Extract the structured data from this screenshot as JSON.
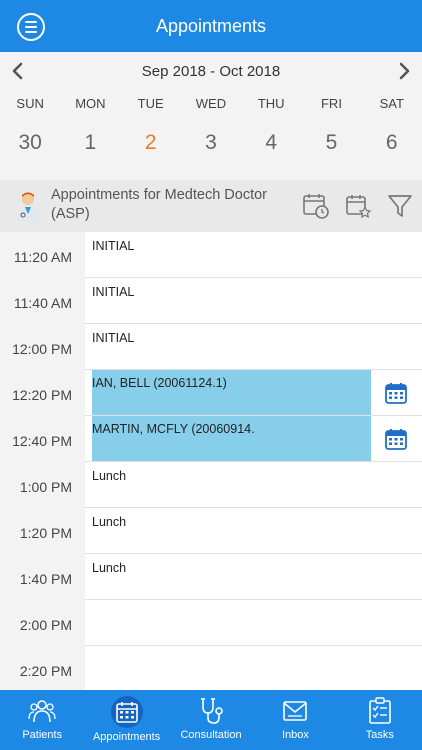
{
  "header": {
    "title": "Appointments"
  },
  "calendar": {
    "range": "Sep 2018 - Oct 2018",
    "days": [
      "SUN",
      "MON",
      "TUE",
      "WED",
      "THU",
      "FRI",
      "SAT"
    ],
    "dates": [
      "30",
      "1",
      "2",
      "3",
      "4",
      "5",
      "6"
    ],
    "today_color": "#e67e22"
  },
  "provider": {
    "name": "Appointments for Medtech Doctor (ASP)"
  },
  "schedule": [
    {
      "time": "11:20 AM",
      "text": "INITIAL",
      "booked": false
    },
    {
      "time": "11:40 AM",
      "text": "INITIAL",
      "booked": false
    },
    {
      "time": "12:00 PM",
      "text": "INITIAL",
      "booked": false
    },
    {
      "time": "12:20 PM",
      "text": "IAN,  BELL (20061124.1)",
      "booked": true
    },
    {
      "time": "12:40 PM",
      "text": "MARTIN,  MCFLY (20060914.",
      "booked": true
    },
    {
      "time": "1:00 PM",
      "text": "Lunch",
      "booked": false
    },
    {
      "time": "1:20 PM",
      "text": "Lunch",
      "booked": false
    },
    {
      "time": "1:40 PM",
      "text": "Lunch",
      "booked": false
    },
    {
      "time": "2:00 PM",
      "text": "",
      "booked": false
    },
    {
      "time": "2:20 PM",
      "text": "",
      "booked": false
    }
  ],
  "nav": {
    "patients": "Patients",
    "appointments": "Appointments",
    "consultation": "Consultation",
    "inbox": "Inbox",
    "tasks": "Tasks"
  },
  "colors": {
    "primary": "#1e88e5",
    "booked": "#87ceeb"
  }
}
